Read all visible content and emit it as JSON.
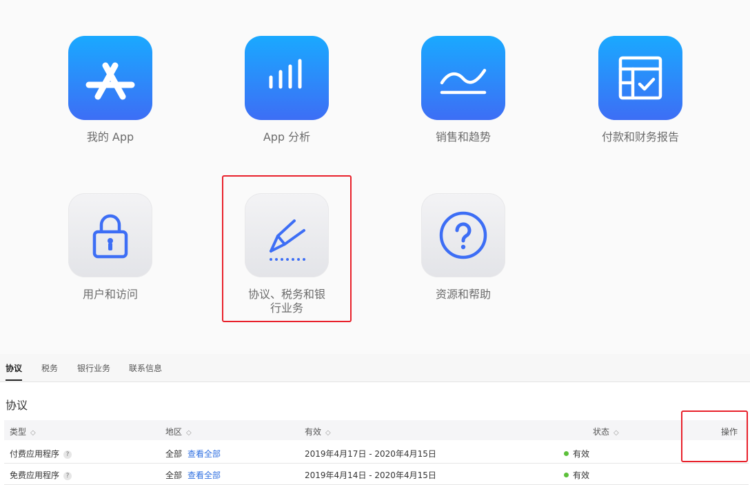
{
  "tiles": [
    {
      "label": "我的 App",
      "icon": "app-store-icon"
    },
    {
      "label": "App 分析",
      "icon": "bar-chart-icon"
    },
    {
      "label": "销售和趋势",
      "icon": "trend-line-icon"
    },
    {
      "label": "付款和财务报告",
      "icon": "finance-report-icon"
    },
    {
      "label": "用户和访问",
      "icon": "lock-icon"
    },
    {
      "label": "协议、税务和银行业务",
      "icon": "signature-icon"
    },
    {
      "label": "资源和帮助",
      "icon": "help-icon"
    }
  ],
  "tabs": [
    "协议",
    "税务",
    "银行业务",
    "联系信息"
  ],
  "section_title": "协议",
  "table": {
    "headers": [
      "类型",
      "地区",
      "有效",
      "状态",
      "操作"
    ],
    "sort_glyph": "◇",
    "rows": [
      {
        "type": "付费应用程序",
        "help": "?",
        "region": "全部",
        "region_link": "查看全部",
        "validity": "2019年4月17日 - 2020年4月15日",
        "status": "有效"
      },
      {
        "type": "免费应用程序",
        "help": "?",
        "region": "全部",
        "region_link": "查看全部",
        "validity": "2019年4月14日 - 2020年4月15日",
        "status": "有效"
      }
    ]
  },
  "colors": {
    "accent_blue": "#3d6ef5",
    "highlight_red": "#e8202a",
    "status_green": "#5cc03a"
  }
}
